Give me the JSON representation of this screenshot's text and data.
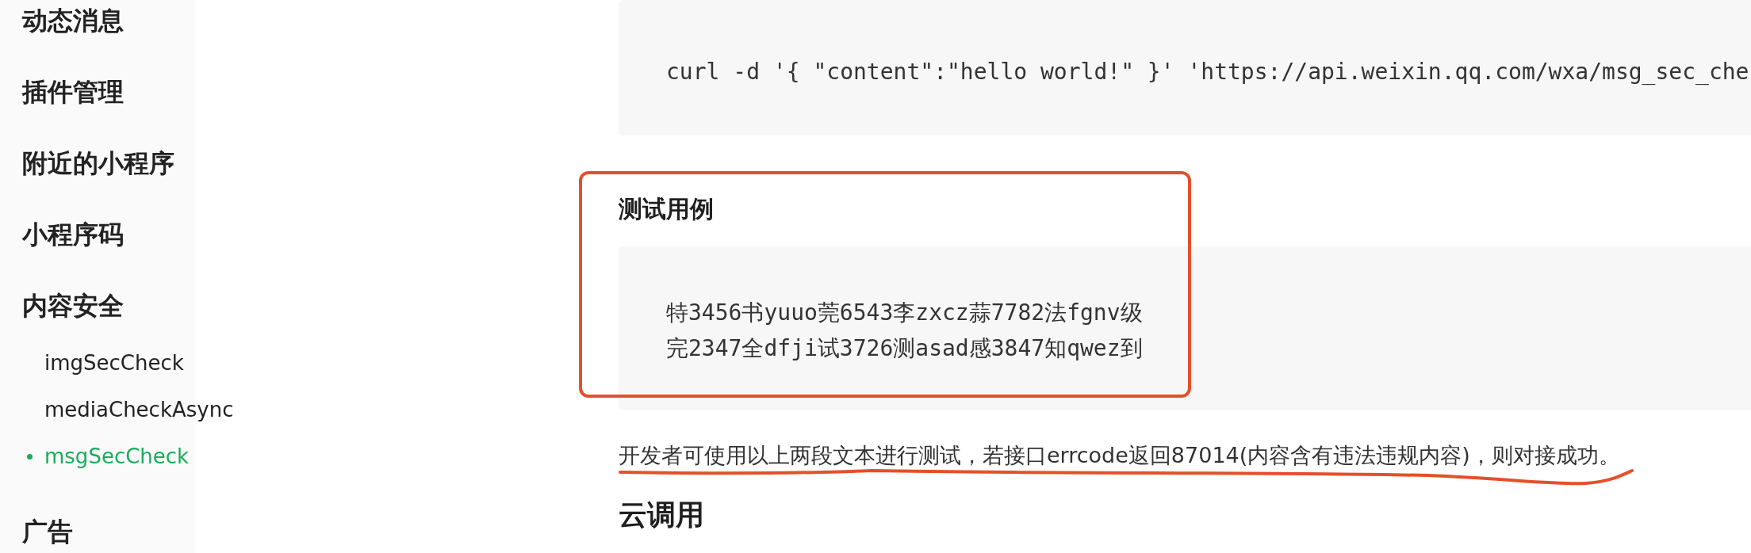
{
  "sidebar": {
    "items": [
      {
        "label": "动态消息",
        "selected": false
      },
      {
        "label": "插件管理",
        "selected": false
      },
      {
        "label": "附近的小程序",
        "selected": false
      },
      {
        "label": "小程序码",
        "selected": false
      },
      {
        "label": "内容安全",
        "selected": false,
        "children": [
          {
            "label": "imgSecCheck",
            "selected": false
          },
          {
            "label": "mediaCheckAsync",
            "selected": false
          },
          {
            "label": "msgSecCheck",
            "selected": true
          }
        ]
      },
      {
        "label": "广告",
        "selected": false
      }
    ]
  },
  "content": [
    {
      "kind": "code",
      "lines": [
        "curl -d '{ \"content\":\"hello world!\" }' 'https://api.weixin.qq.com/wxa/msg_sec_che"
      ]
    },
    {
      "kind": "heading",
      "text": "测试用例"
    },
    {
      "kind": "code",
      "lines": [
        "特3456书yuuo莞6543李zxcz蒜7782法fgnv级",
        "完2347全dfji试3726测asad感3847知qwez到"
      ]
    },
    {
      "kind": "paragraph",
      "text": "开发者可使用以上两段文本进行测试，若接口errcode返回87014(内容含有违法违规内容)，则对接成功。"
    },
    {
      "kind": "section-heading",
      "text": "云调用"
    }
  ]
}
